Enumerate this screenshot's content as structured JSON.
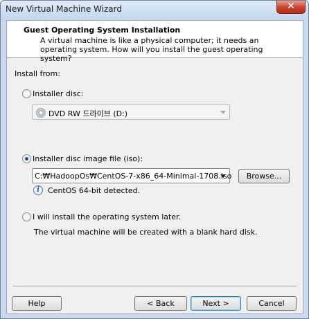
{
  "window": {
    "title": "New Virtual Machine Wizard",
    "close_glyph": "✕"
  },
  "header": {
    "title": "Guest Operating System Installation",
    "description": "A virtual machine is like a physical computer; it needs an operating system. How will you install the guest operating system?"
  },
  "install_from": {
    "label": "Install from:",
    "installer_disc": {
      "label": "Installer disc:",
      "selected": false,
      "drive_value": "DVD RW 드라이브 (D:)",
      "enabled": false
    },
    "iso": {
      "label": "Installer disc image file (iso):",
      "selected": true,
      "path_value": "C:₩HadoopOs₩CentOS-7-x86_64-Minimal-1708.iso",
      "browse_label": "Browse...",
      "detected_text": "CentOS 64-bit detected."
    },
    "later": {
      "label": "I will install the operating system later.",
      "selected": false,
      "note": "The virtual machine will be created with a blank hard disk."
    }
  },
  "footer": {
    "help_label": "Help",
    "back_label": "< Back",
    "next_label": "Next >",
    "cancel_label": "Cancel"
  },
  "colors": {
    "frame": "#c9daee",
    "close_button": "#c7402a",
    "radio_selected": "#1a4fa0",
    "default_button_border": "#3c7fb1"
  },
  "icons": [
    "close-icon",
    "disc-icon",
    "info-icon",
    "dropdown-arrow-icon"
  ]
}
